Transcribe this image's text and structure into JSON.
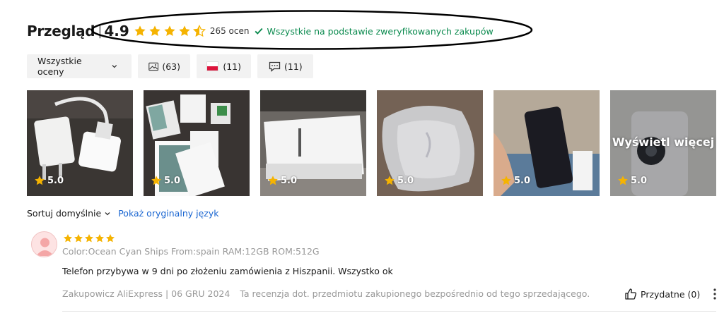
{
  "overview": {
    "title": "Przegląd",
    "separator": "|",
    "score": "4.9",
    "stars": [
      1,
      1,
      1,
      1,
      0.5
    ],
    "ratings_count": "265 ocen",
    "verified_text": "Wszystkie na podstawie zweryfikowanych zakupów",
    "star_color": "#f5b301",
    "verified_color": "#0a8a4e"
  },
  "filters": {
    "all_ratings": "Wszystkie oceny",
    "photos_count": "(63)",
    "country_count": "(11)",
    "comments_count": "(11)"
  },
  "gallery": [
    {
      "rating": "5.0",
      "icon": "charger-photo"
    },
    {
      "rating": "5.0",
      "icon": "unboxed-phone-photo"
    },
    {
      "rating": "5.0",
      "icon": "honor-box-photo"
    },
    {
      "rating": "5.0",
      "icon": "package-photo"
    },
    {
      "rating": "5.0",
      "icon": "phone-in-hand-photo"
    },
    {
      "rating": "5.0",
      "icon": "phone-back-photo",
      "overlay": "Wyświetl więcej"
    }
  ],
  "sort": {
    "label": "Sortuj domyślnie",
    "original_language": "Pokaż oryginalny język"
  },
  "review": {
    "stars": 5,
    "variant": "Color:Ocean Cyan Ships From:spain RAM:12GB ROM:512G",
    "text": "Telefon przybywa w 9 dni po złożeniu zamówienia z Hiszpanii. Wszystko ok",
    "author_date": "Zakupowicz AliExpress | 06 GRU 2024",
    "note": "Ta recenzja dot. przedmiotu zakupionego bezpośrednio od tego sprzedającego.",
    "helpful": "Przydatne (0)"
  }
}
